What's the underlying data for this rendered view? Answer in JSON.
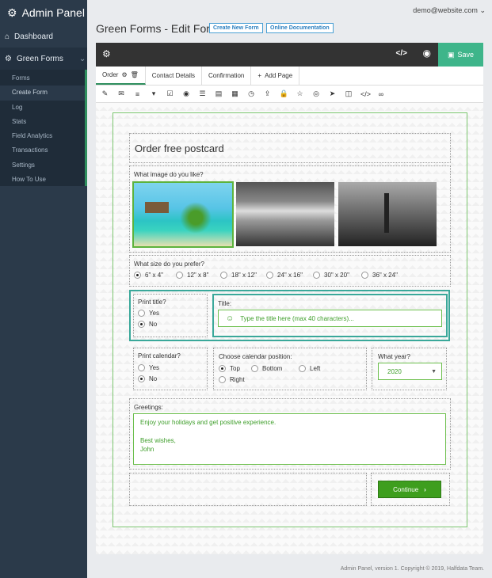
{
  "sidebar": {
    "brand": "Admin Panel",
    "dashboard": "Dashboard",
    "section": "Green Forms",
    "items": [
      "Forms",
      "Create Form",
      "Log",
      "Stats",
      "Field Analytics",
      "Transactions",
      "Settings",
      "How To Use"
    ]
  },
  "header": {
    "user": "demo@website.com",
    "title": "Green Forms - Edit Form",
    "create_btn": "Create New Form",
    "docs_btn": "Online Documentation",
    "save": "Save"
  },
  "tabs": {
    "order": "Order",
    "contact": "Contact Details",
    "confirmation": "Confirmation",
    "add_page": "Add Page"
  },
  "form": {
    "heading": "Order free postcard",
    "image_q": "What image do you like?",
    "size_q": "What size do you prefer?",
    "sizes": [
      "6\" x 4\"",
      "12\" x 8\"",
      "18\" x 12\"",
      "24\" x 16\"",
      "30\" x 20\"",
      "36\" x 24\""
    ],
    "print_title_q": "Print title?",
    "yes": "Yes",
    "no": "No",
    "title_label": "Title:",
    "title_placeholder": "Type the title here (max 40 characters)...",
    "print_cal_q": "Print calendar?",
    "cal_pos_q": "Choose calendar position:",
    "pos_top": "Top",
    "pos_bottom": "Bottom",
    "pos_left": "Left",
    "pos_right": "Right",
    "year_q": "What year?",
    "year": "2020",
    "greetings_label": "Greetings:",
    "greet_1": "Enjoy your holidays and get positive experience.",
    "greet_2": "Best wishes,",
    "greet_3": "John",
    "continue": "Continue"
  },
  "footer": "Admin Panel, version 1. Copyright © 2019, Halfdata Team.",
  "colors": {
    "accent": "#3eb58a",
    "sidebar": "#2b3a4a",
    "field": "#6cbf4c",
    "continue": "#3e9e1e"
  }
}
